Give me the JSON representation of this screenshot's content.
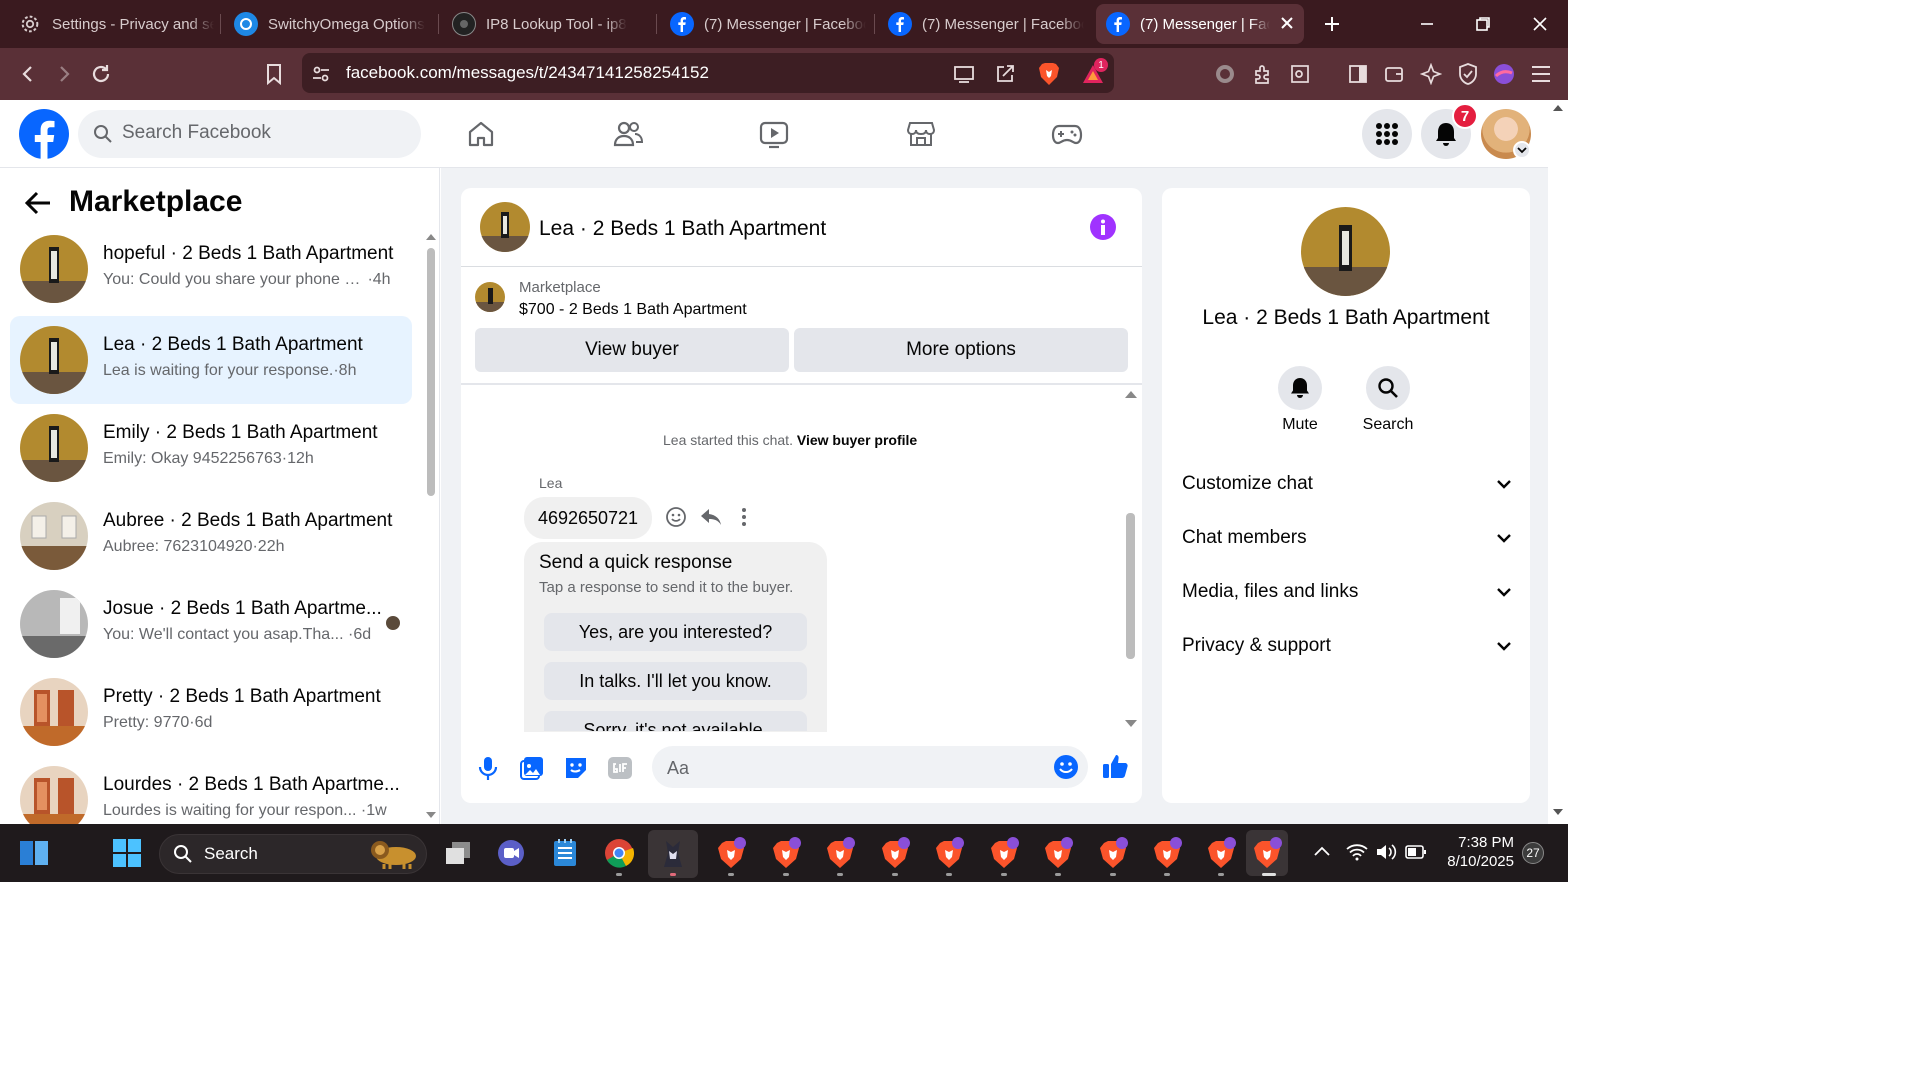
{
  "browser": {
    "tabs": [
      {
        "title": "Settings - Privacy and se",
        "icon": "gear-icon"
      },
      {
        "title": "SwitchyOmega Options",
        "icon": "switchyomega-icon"
      },
      {
        "title": "IP8 Lookup Tool - ip8",
        "icon": "ip8-icon"
      },
      {
        "title": "(7) Messenger | Faceboo",
        "icon": "facebook-icon"
      },
      {
        "title": "(7) Messenger | Faceboo",
        "icon": "facebook-icon"
      },
      {
        "title": "(7) Messenger | Face",
        "icon": "facebook-icon",
        "active": true
      }
    ],
    "url": "facebook.com/messages/t/24347141258254152",
    "brave_rewards_badge": "1"
  },
  "facebook": {
    "search_placeholder": "Search Facebook",
    "notifications_count": "7"
  },
  "left_panel": {
    "title": "Marketplace",
    "conversations": [
      {
        "name": "hopeful · 2 Beds 1 Bath Apartment",
        "preview": "You: Could you share your phone n...",
        "time": "4h",
        "selected": false,
        "thumb": "room-yellow"
      },
      {
        "name": "Lea · 2 Beds 1 Bath Apartment",
        "preview": "Lea is waiting for your response.",
        "time": "8h",
        "selected": true,
        "thumb": "room-yellow"
      },
      {
        "name": "Emily · 2 Beds 1 Bath Apartment",
        "preview": "Emily: Okay 9452256763",
        "time": "12h",
        "selected": false,
        "thumb": "room-yellow"
      },
      {
        "name": "Aubree · 2 Beds 1 Bath Apartment",
        "preview": "Aubree: 7623104920",
        "time": "22h",
        "selected": false,
        "thumb": "room-light"
      },
      {
        "name": "Josue · 2 Beds 1 Bath Apartme...",
        "preview": "You: We'll contact you asap.Tha...",
        "time": "6d",
        "selected": false,
        "thumb": "room-gray"
      },
      {
        "name": "Pretty · 2 Beds 1 Bath Apartment",
        "preview": "Pretty: 9770",
        "time": "6d",
        "selected": false,
        "thumb": "room-orange"
      },
      {
        "name": "Lourdes · 2 Beds 1 Bath Apartme...",
        "preview": "Lourdes is waiting for your respon...",
        "time": "1w",
        "selected": false,
        "thumb": "room-orange"
      }
    ]
  },
  "chat": {
    "header_title": "Lea · 2 Beds 1 Bath Apartment",
    "listing_source": "Marketplace",
    "listing_title": "$700 - 2 Beds 1 Bath Apartment",
    "view_buyer": "View buyer",
    "more_options": "More options",
    "started_text": "Lea started this chat.",
    "view_buyer_profile": "View buyer profile",
    "sender_name": "Lea",
    "message": "4692650721",
    "quick_response_title": "Send a quick response",
    "quick_response_sub": "Tap a response to send it to the buyer.",
    "quick_responses": [
      "Yes, are you interested?",
      "In talks. I'll let you know.",
      "Sorry, it's not available."
    ],
    "composer_placeholder": "Aa"
  },
  "right_panel": {
    "name": "Lea · 2 Beds 1 Bath Apartment",
    "mute_label": "Mute",
    "search_label": "Search",
    "sections": [
      "Customize chat",
      "Chat members",
      "Media, files and links",
      "Privacy & support"
    ]
  },
  "taskbar": {
    "search_label": "Search",
    "time": "7:38 PM",
    "date": "8/10/2025",
    "weather_badge": "27"
  },
  "colors": {
    "fb_blue": "#0866ff",
    "selected_bg": "#e7f3ff",
    "info_purple": "#a033ff",
    "tab_bg": "#3a1a1f",
    "toolbar_bg": "#5a3037"
  }
}
